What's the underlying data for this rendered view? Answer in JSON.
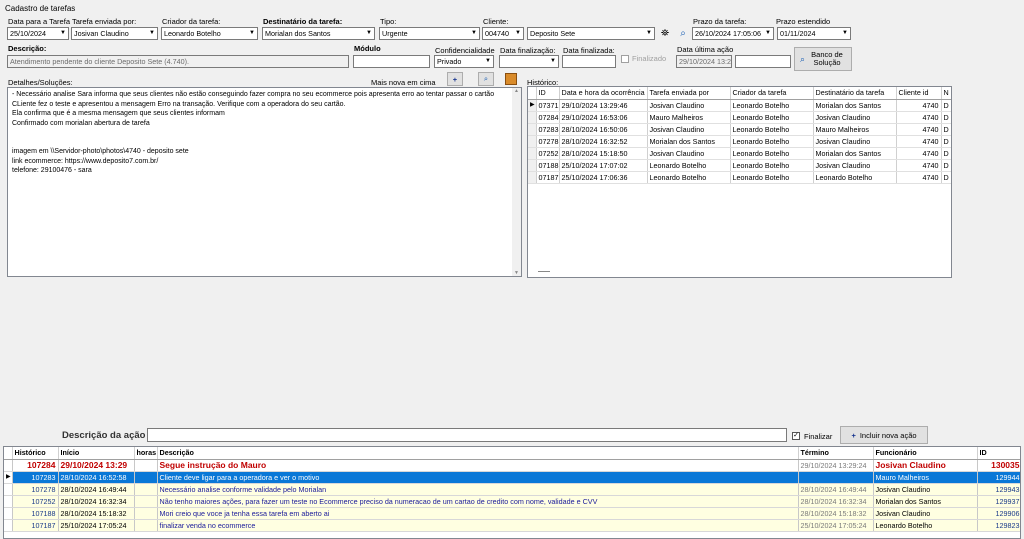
{
  "window_title": "Cadastro de tarefas",
  "form": {
    "data_tarefa": {
      "label": "Data para a Tarefa",
      "value": "25/10/2024"
    },
    "enviada_por": {
      "label": "Tarefa enviada por:",
      "value": "Josivan Claudino"
    },
    "criador": {
      "label": "Criador da tarefa:",
      "value": "Leonardo Botelho"
    },
    "destinatario": {
      "label": "Destinatário da tarefa:",
      "value": "Morialan dos Santos"
    },
    "tipo": {
      "label": "Tipo:",
      "value": "Urgente"
    },
    "cliente": {
      "label": "Cliente:",
      "code": "004740",
      "name": "Deposito Sete"
    },
    "prazo": {
      "label": "Prazo da tarefa:",
      "value": "26/10/2024 17:05:06"
    },
    "prazo_estendido": {
      "label": "Prazo estendido",
      "value": "01/11/2024"
    },
    "descricao": {
      "label": "Descrição:",
      "value": "Atendimento pendente do cliente Deposito Sete  (4.740)."
    },
    "modulo": {
      "label": "Módulo",
      "value": ""
    },
    "confidencialidade": {
      "label": "Confidencialidade",
      "value": "Privado"
    },
    "data_finalizacao": {
      "label": "Data finalização:",
      "value": ""
    },
    "data_finalizada": {
      "label": "Data finalizada:",
      "value": ""
    },
    "finalizado_label": "Finalizado",
    "ultima_acao": {
      "label": "Data última ação",
      "value": "29/10/2024 13:2"
    },
    "banco_solucao": "Banco de Solução",
    "detalhes_label": "Detalhes/Soluções:",
    "mais_nova": "Mais nova em cima",
    "historico_label": "Histórico:",
    "detalhes_lines": [
      " - Necessário analise Sara informa que seus clientes não estão conseguindo fazer compra no seu ecommerce pois apresenta erro ao tentar passar o cartão",
      "CLiente fez o teste e apresentou a mensagem Erro na transação. Verifique com a operadora do seu cartão.",
      "Ela confirma que é a mesma mensagem que seus clientes informam",
      "Confirmado com morialan abertura de tarefa",
      "",
      "",
      "imagem em \\\\Servidor-photo\\photos\\4740 - deposito sete",
      "link ecommerce: https://www.deposito7.com.br/",
      "telefone: 29100476 - sara"
    ]
  },
  "history": {
    "columns": [
      "ID",
      "Data e hora da ocorrência",
      "Tarefa enviada por",
      "Criador da tarefa",
      "Destinatário da tarefa",
      "Cliente id",
      "N"
    ],
    "rows": [
      [
        "07371",
        "29/10/2024 13:29:46",
        "Josivan Claudino",
        "Leonardo Botelho",
        "Morialan dos Santos",
        "4740",
        "D"
      ],
      [
        "07284",
        "29/10/2024 16:53:06",
        "Mauro Malheiros",
        "Leonardo Botelho",
        "Josivan Claudino",
        "4740",
        "D"
      ],
      [
        "07283",
        "28/10/2024 16:50:06",
        "Josivan Claudino",
        "Leonardo Botelho",
        "Mauro Malheiros",
        "4740",
        "D"
      ],
      [
        "07278",
        "28/10/2024 16:32:52",
        "Morialan dos Santos",
        "Leonardo Botelho",
        "Josivan Claudino",
        "4740",
        "D"
      ],
      [
        "07252",
        "28/10/2024 15:18:50",
        "Josivan Claudino",
        "Leonardo Botelho",
        "Morialan dos Santos",
        "4740",
        "D"
      ],
      [
        "07188",
        "25/10/2024 17:07:02",
        "Leonardo Botelho",
        "Leonardo Botelho",
        "Josivan Claudino",
        "4740",
        "D"
      ],
      [
        "07187",
        "25/10/2024 17:06:36",
        "Leonardo Botelho",
        "Leonardo Botelho",
        "Leonardo Botelho",
        "4740",
        "D"
      ]
    ]
  },
  "action": {
    "descricao_label": "Descrição da ação",
    "finalizar_label": "Finalizar",
    "incluir_label": "Incluir nova ação"
  },
  "actions_table": {
    "columns": [
      "Histórico",
      "Início",
      "horas",
      "Descrição",
      "Término",
      "Funcionário",
      "ID"
    ],
    "header_row": [
      "107284",
      "29/10/2024 13:29",
      "",
      "Segue instrução do Mauro",
      "29/10/2024 13:29:24",
      "Josivan Claudino",
      "130035"
    ],
    "rows": [
      [
        "107283",
        "28/10/2024 16:52:58",
        "",
        "Cliente deve ligar para a operadora e ver o motivo",
        "",
        "Mauro Malheiros",
        "129944"
      ],
      [
        "107278",
        "28/10/2024 16:49:44",
        "",
        "Necessário analise conforme validade pelo Morialan",
        "28/10/2024 16:49:44",
        "Josivan Claudino",
        "129943"
      ],
      [
        "107252",
        "28/10/2024 16:32:34",
        "",
        "Não tenho maiores ações, para fazer um teste no Ecommerce preciso da numeracao de um cartao de credito com nome, validade e CVV",
        "28/10/2024 16:32:34",
        "Morialan dos Santos",
        "129937"
      ],
      [
        "107188",
        "28/10/2024 15:18:32",
        "",
        "Mori creio que voce ja tenha essa tarefa em aberto ai",
        "28/10/2024 15:18:32",
        "Josivan Claudino",
        "129906"
      ],
      [
        "107187",
        "25/10/2024 17:05:24",
        "",
        "finalizar venda no ecommerce",
        "25/10/2024 17:05:24",
        "Leonardo Botelho",
        "129823"
      ]
    ]
  }
}
